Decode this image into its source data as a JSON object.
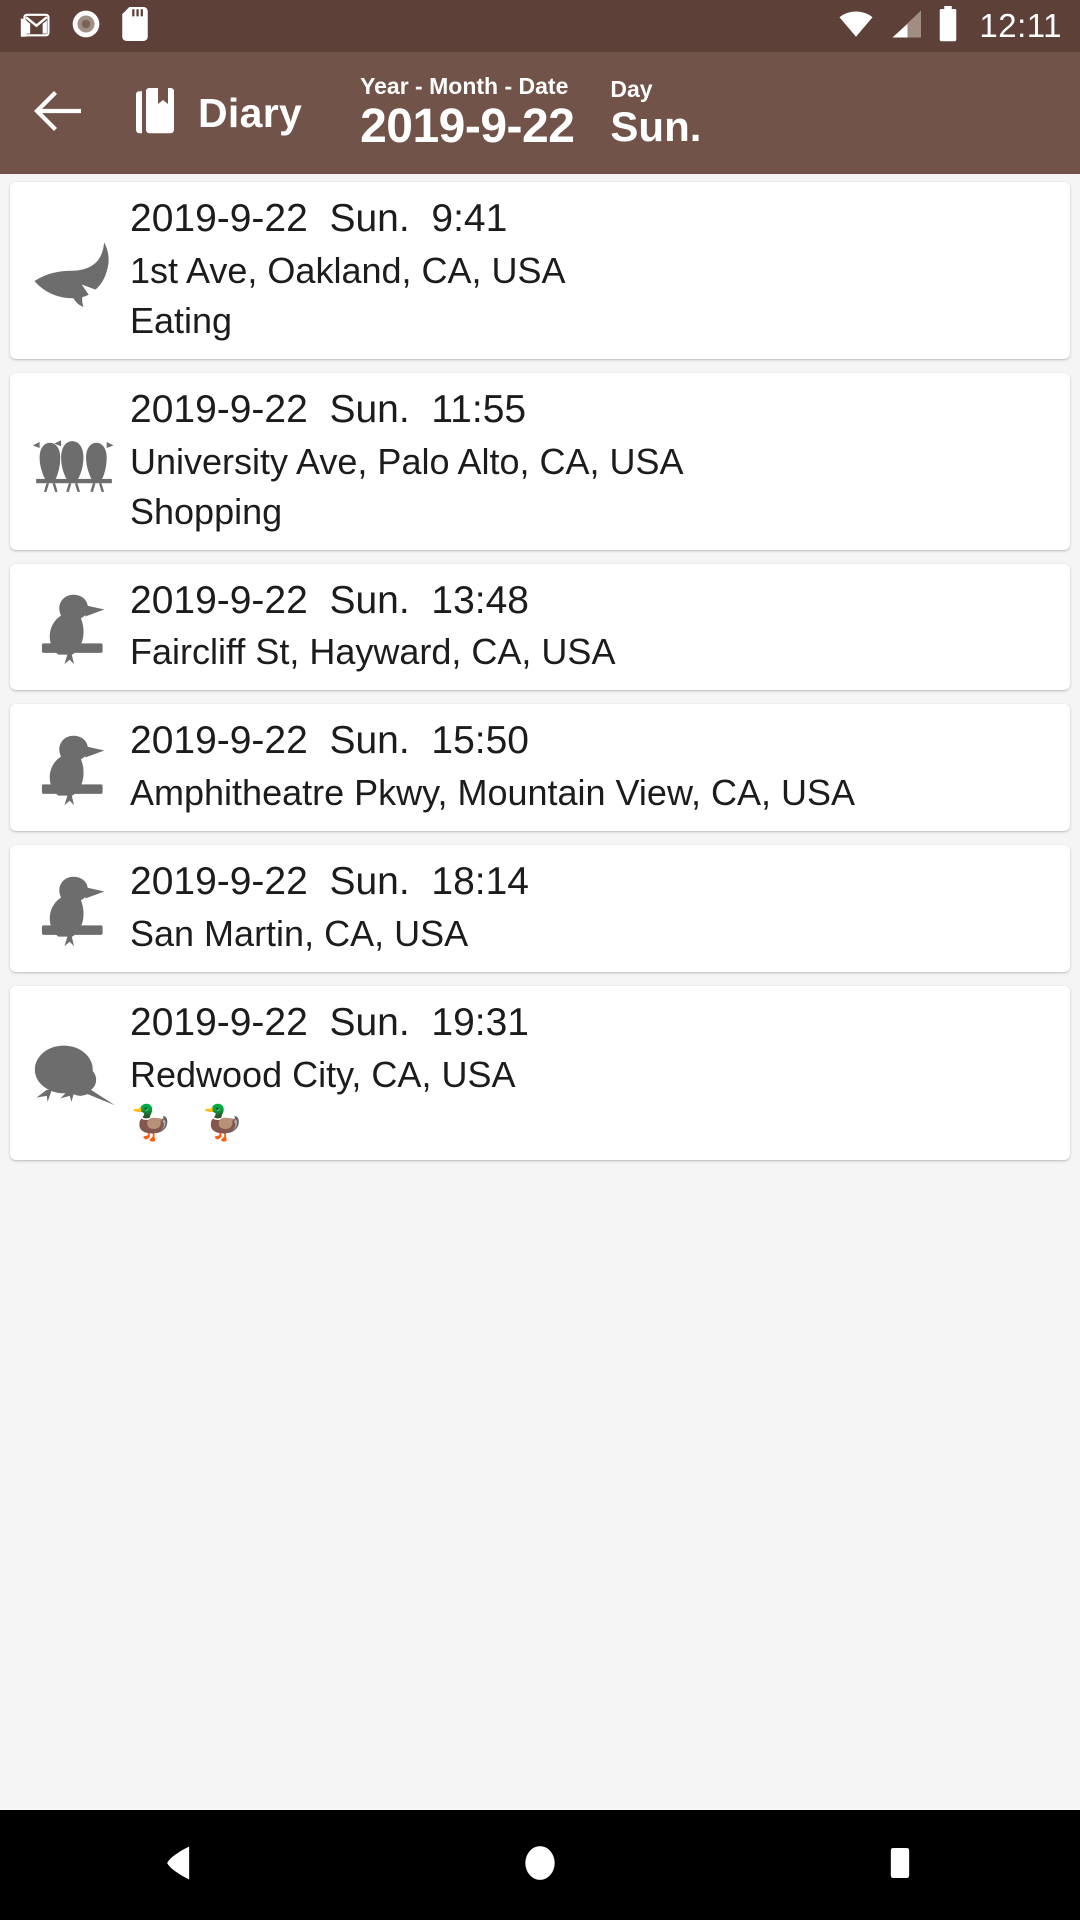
{
  "statusbar": {
    "background": "#5d4037",
    "clock": "12:11",
    "left_icons": [
      "gmail-icon",
      "record-icon",
      "sdcard-icon"
    ],
    "right_icons": [
      "wifi-icon",
      "cellular-signal-icon",
      "battery-icon"
    ]
  },
  "appbar": {
    "background": "#71534a",
    "back_label": "back-arrow-icon",
    "app_icon": "diary-book-icon",
    "title": "Diary",
    "date_caption": "Year - Month - Date",
    "date_value": "2019-9-22",
    "day_caption": "Day",
    "day_value": "Sun."
  },
  "list": {
    "items": [
      {
        "icon": "flying-bird-icon",
        "datetime": "2019-9-22  Sun.  9:41",
        "place": "1st Ave, Oakland, CA, USA",
        "note": "Eating"
      },
      {
        "icon": "three-birds-on-perch-icon",
        "datetime": "2019-9-22  Sun.  11:55",
        "place": "University Ave, Palo Alto, CA, USA",
        "note": "Shopping"
      },
      {
        "icon": "perched-bird-icon",
        "datetime": "2019-9-22  Sun.  13:48",
        "place": "Faircliff St, Hayward, CA, USA",
        "note": ""
      },
      {
        "icon": "perched-bird-icon",
        "datetime": "2019-9-22  Sun.  15:50",
        "place": "Amphitheatre Pkwy, Mountain View, CA, USA",
        "note": ""
      },
      {
        "icon": "perched-bird-icon",
        "datetime": "2019-9-22  Sun.  18:14",
        "place": "San Martin, CA, USA",
        "note": ""
      },
      {
        "icon": "kiwi-bird-icon",
        "datetime": "2019-9-22  Sun.  19:31",
        "place": "Redwood City, CA, USA",
        "note": "🦆 🦆"
      }
    ]
  },
  "navbar": {
    "background": "#000000",
    "back": "nav-back-icon",
    "home": "nav-home-icon",
    "recents": "nav-recents-icon"
  }
}
